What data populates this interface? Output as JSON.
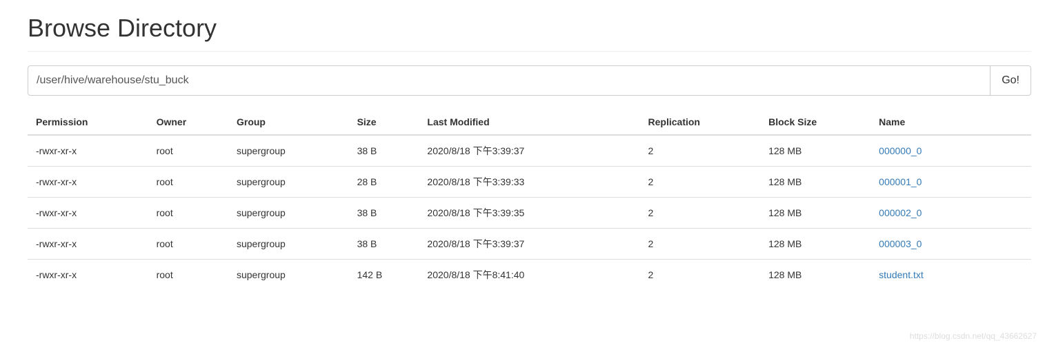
{
  "page_title": "Browse Directory",
  "path_input": {
    "value": "/user/hive/warehouse/stu_buck"
  },
  "go_button_label": "Go!",
  "table": {
    "headers": {
      "permission": "Permission",
      "owner": "Owner",
      "group": "Group",
      "size": "Size",
      "last_modified": "Last Modified",
      "replication": "Replication",
      "block_size": "Block Size",
      "name": "Name"
    },
    "rows": [
      {
        "permission": "-rwxr-xr-x",
        "owner": "root",
        "group": "supergroup",
        "size": "38 B",
        "last_modified": "2020/8/18 下午3:39:37",
        "replication": "2",
        "block_size": "128 MB",
        "name": "000000_0"
      },
      {
        "permission": "-rwxr-xr-x",
        "owner": "root",
        "group": "supergroup",
        "size": "28 B",
        "last_modified": "2020/8/18 下午3:39:33",
        "replication": "2",
        "block_size": "128 MB",
        "name": "000001_0"
      },
      {
        "permission": "-rwxr-xr-x",
        "owner": "root",
        "group": "supergroup",
        "size": "38 B",
        "last_modified": "2020/8/18 下午3:39:35",
        "replication": "2",
        "block_size": "128 MB",
        "name": "000002_0"
      },
      {
        "permission": "-rwxr-xr-x",
        "owner": "root",
        "group": "supergroup",
        "size": "38 B",
        "last_modified": "2020/8/18 下午3:39:37",
        "replication": "2",
        "block_size": "128 MB",
        "name": "000003_0"
      },
      {
        "permission": "-rwxr-xr-x",
        "owner": "root",
        "group": "supergroup",
        "size": "142 B",
        "last_modified": "2020/8/18 下午8:41:40",
        "replication": "2",
        "block_size": "128 MB",
        "name": "student.txt"
      }
    ]
  },
  "watermark": "https://blog.csdn.net/qq_43662627"
}
